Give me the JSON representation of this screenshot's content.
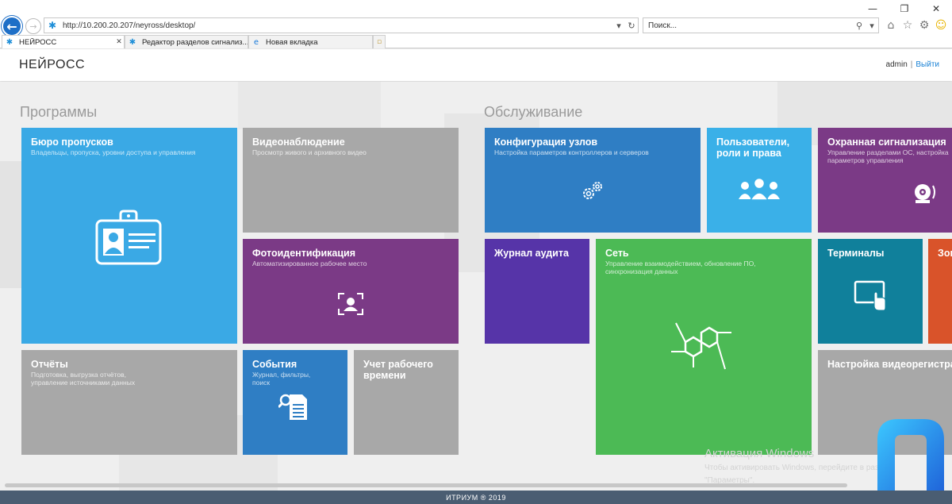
{
  "browser": {
    "url": "http://10.200.20.207/neyross/desktop/",
    "search_placeholder": "Поиск...",
    "tabs": [
      {
        "label": "НЕЙРОСС",
        "active": true
      },
      {
        "label": "Редактор разделов сигнализ...",
        "active": false
      },
      {
        "label": "Новая вкладка",
        "active": false
      }
    ],
    "tab_close_glyph": "✕",
    "window_controls": [
      "—",
      "❐",
      "✕"
    ],
    "nav": {
      "back_glyph": "←",
      "forward_glyph": "→"
    },
    "toolbar_icons": [
      "home-icon",
      "star-icon",
      "gear-icon",
      "smiley-icon"
    ]
  },
  "header": {
    "brand": "НЕЙРОСС",
    "user": "admin",
    "separator": "|",
    "logout": "Выйти"
  },
  "sections": {
    "programs": "Программы",
    "service": "Обслуживание"
  },
  "tiles": {
    "bureau": {
      "title": "Бюро пропусков",
      "desc": "Владельцы, пропуска, уровни доступа и управления",
      "color": "#3aa9e5"
    },
    "video": {
      "title": "Видеонаблюдение",
      "desc": "Просмотр живого и архивного видео",
      "color": "#a8a8a8"
    },
    "photo": {
      "title": "Фотоидентификация",
      "desc": "Автоматизированное рабочее место",
      "color": "#7b3a86"
    },
    "reports": {
      "title": "Отчёты",
      "desc": "Подготовка, выгрузка отчётов, управление источниками данных",
      "color": "#a8a8a8"
    },
    "events": {
      "title": "События",
      "desc": "Журнал, фильтры, поиск",
      "color": "#2f7ec4"
    },
    "worktime": {
      "title": "Учет рабочего времени",
      "desc": "",
      "color": "#a8a8a8"
    },
    "nodes": {
      "title": "Конфигурация узлов",
      "desc": "Настройка параметров контроллеров и серверов",
      "color": "#2f7ec4"
    },
    "users": {
      "title": "Пользователи, роли и права",
      "desc": "",
      "color": "#3ab0e8"
    },
    "security": {
      "title": "Охранная сигнализация",
      "desc": "Управление разделами ОС, настройка параметров управления",
      "color": "#7b3a86"
    },
    "audit": {
      "title": "Журнал аудита",
      "desc": "",
      "color": "#5634a8"
    },
    "network": {
      "title": "Сеть",
      "desc": "Управление взаимодействием, обновление ПО, синхронизация данных",
      "color": "#4cba55"
    },
    "terminals": {
      "title": "Терминалы",
      "desc": "",
      "color": "#10809b"
    },
    "zones": {
      "title": "Зоны",
      "desc": "",
      "color": "#d9532a"
    },
    "nvr": {
      "title": "Настройка видеорегистраторов",
      "desc": "",
      "color": "#a8a8a8"
    }
  },
  "activation": {
    "title": "Активация Windows",
    "line1": "Чтобы активировать Windows, перейдите в раздел",
    "line2": "\"Параметры\"."
  },
  "footer": "ИТРИУМ ® 2019"
}
